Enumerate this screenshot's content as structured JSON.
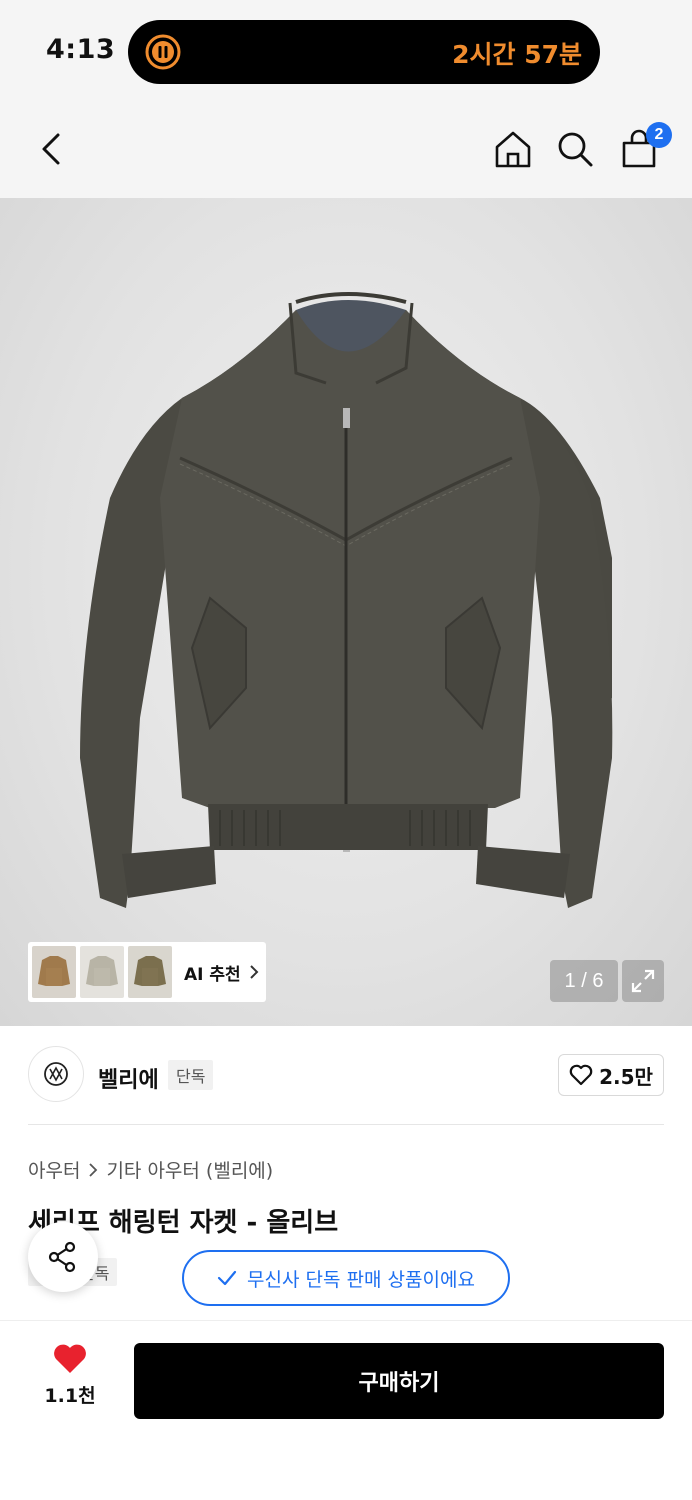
{
  "status_bar": {
    "time": "4:13",
    "timer": "2시간 57분",
    "accent_color": "#f08c2e"
  },
  "nav": {
    "icons": [
      "chevron-left-icon",
      "home-icon",
      "search-icon",
      "shopping-bag-icon"
    ],
    "cart_count": "2",
    "badge_color": "#1e6ff0"
  },
  "gallery": {
    "ai_recommend_label": "AI 추천",
    "recommend_thumbs": [
      "tan-jacket",
      "beige-jacket",
      "olive-jacket"
    ],
    "current_image": "1",
    "total_images": "6",
    "counter_text": "1 / 6"
  },
  "brand": {
    "name": "벨리에",
    "badge": "단독",
    "like_count": "2.5만"
  },
  "breadcrumb": {
    "category": "아우터",
    "subcategory": "기타 아우터 (벨리에)"
  },
  "product": {
    "title": "세리프 해링턴 자켓 - 올리브",
    "exclusive_tag": "단독",
    "exclusive_notice": "무신사 단독 판매 상품이에요",
    "accent_color": "#1e6ff0"
  },
  "bottom_bar": {
    "wish_count": "1.1천",
    "buy_label": "구매하기",
    "heart_color": "#e8222e"
  }
}
